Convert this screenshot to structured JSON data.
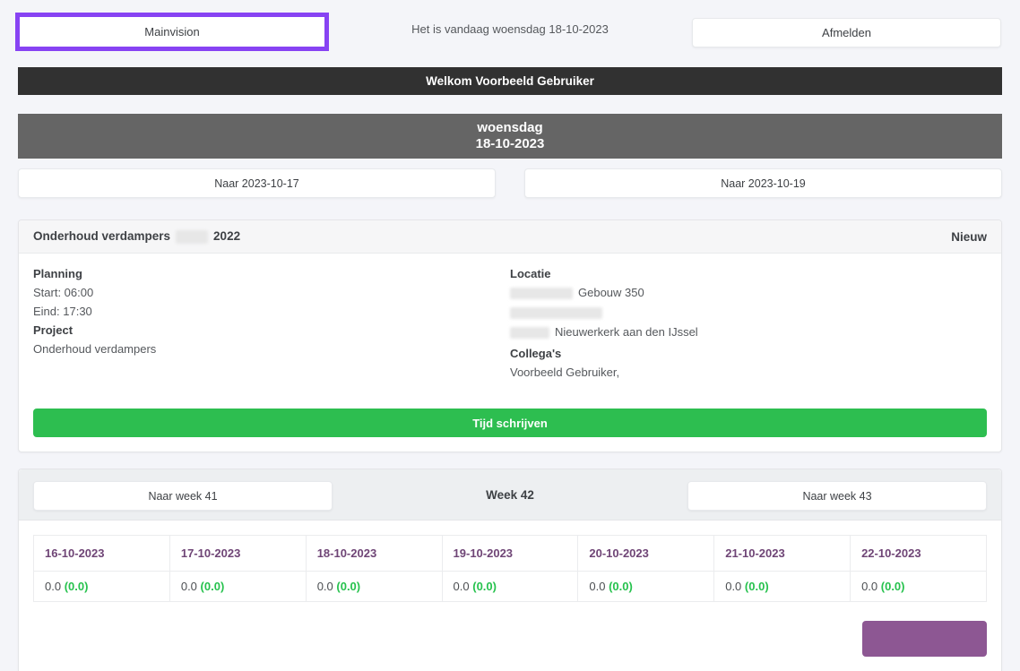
{
  "topbar": {
    "brand_label": "Mainvision",
    "today_text": "Het is vandaag woensdag 18-10-2023",
    "logout_label": "Afmelden"
  },
  "welcome_banner": {
    "text": "Welkom Voorbeeld Gebruiker"
  },
  "day_header": {
    "line1": "woensdag",
    "line2": "18-10-2023"
  },
  "day_nav": {
    "prev_label": "Naar 2023-10-17",
    "next_label": "Naar 2023-10-19"
  },
  "appointment_card": {
    "title_prefix": "Onderhoud verdampers",
    "title_suffix": "2022",
    "badge": "Nieuw",
    "planning_heading": "Planning",
    "start": "Start: 06:00",
    "end": "Eind: 17:30",
    "project_heading": "Project",
    "project_value": "Onderhoud verdampers",
    "location_heading": "Locatie",
    "location_line1": "Gebouw 350",
    "location_line3": "Nieuwerkerk aan den IJssel",
    "colleagues_heading": "Collega's",
    "colleagues_value": "Voorbeeld Gebruiker,",
    "action_label": "Tijd schrijven"
  },
  "week_card": {
    "prev_label": "Naar week 41",
    "current_label": "Week 42",
    "next_label": "Naar week 43",
    "table": {
      "columns": [
        "16-10-2023",
        "17-10-2023",
        "18-10-2023",
        "19-10-2023",
        "20-10-2023",
        "21-10-2023",
        "22-10-2023"
      ],
      "cells": [
        {
          "value": "0.0",
          "extra": "(0.0)"
        },
        {
          "value": "0.0",
          "extra": "(0.0)"
        },
        {
          "value": "0.0",
          "extra": "(0.0)"
        },
        {
          "value": "0.0",
          "extra": "(0.0)"
        },
        {
          "value": "0.0",
          "extra": "(0.0)"
        },
        {
          "value": "0.0",
          "extra": "(0.0)"
        },
        {
          "value": "0.0",
          "extra": "(0.0)"
        }
      ]
    }
  },
  "colors": {
    "accent_purple": "#8743f3",
    "action_green": "#2dbe50",
    "value_green": "#27c24e",
    "table_header_purple": "#6f4576",
    "bottom_button_purple": "#8d5793",
    "banner_dark": "#313131",
    "banner_gray": "#656565",
    "page_background": "#f4f5f9"
  }
}
